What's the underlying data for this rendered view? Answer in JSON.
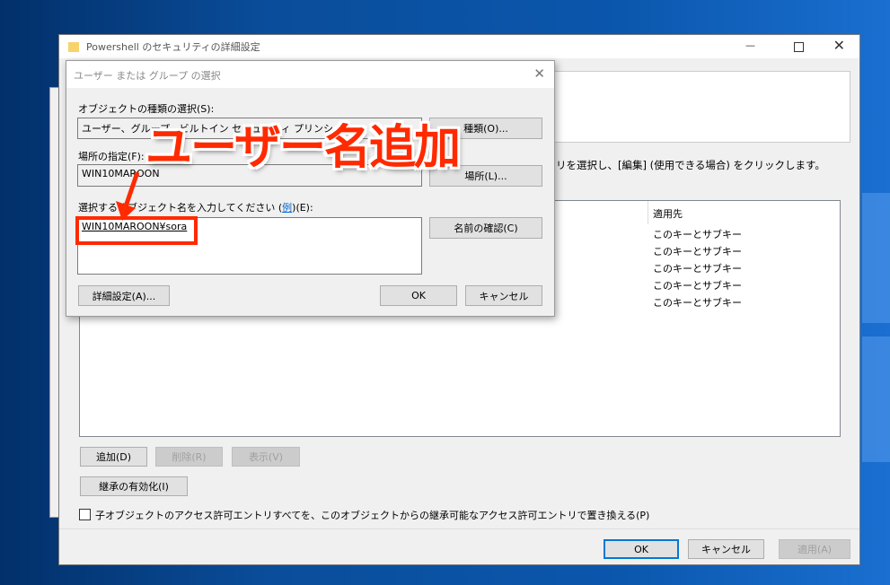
{
  "main_window": {
    "title": "Powershell のセキュリティの詳細設定",
    "instruction": "ントリを選択し、[編集] (使用できる場合) をクリックします。",
    "column_header": "適用先",
    "rows": [
      "このキーとサブキー",
      "このキーとサブキー",
      "このキーとサブキー",
      "このキーとサブキー",
      "このキーとサブキー"
    ],
    "add_label": "追加(D)",
    "remove_label": "削除(R)",
    "view_label": "表示(V)",
    "inherit_label": "継承の有効化(I)",
    "replace_checkbox_label": "子オブジェクトのアクセス許可エントリすべてを、このオブジェクトからの継承可能なアクセス許可エントリで置き換える(P)",
    "ok_label": "OK",
    "cancel_label": "キャンセル",
    "apply_label": "適用(A)"
  },
  "dialog": {
    "title": "ユーザー または グループ の選択",
    "object_type_label": "オブジェクトの種類の選択(S):",
    "object_type_value": "ユーザー、グループ、ビルトイン セキュリティ プリンシパル",
    "object_type_button": "種類(O)...",
    "location_label": "場所の指定(F):",
    "location_value": "WIN10MAROON",
    "location_button": "場所(L)...",
    "name_label": "選択するオブジェクト名を入力してください",
    "example_link": "例",
    "name_label_suffix": "(E):",
    "name_value": "WIN10MAROON¥sora",
    "check_names_button": "名前の確認(C)",
    "advanced_button": "詳細設定(A)...",
    "ok_label": "OK",
    "cancel_label": "キャンセル"
  },
  "annotation": {
    "text": "ユーザー名追加",
    "color": "#ff2a00"
  }
}
